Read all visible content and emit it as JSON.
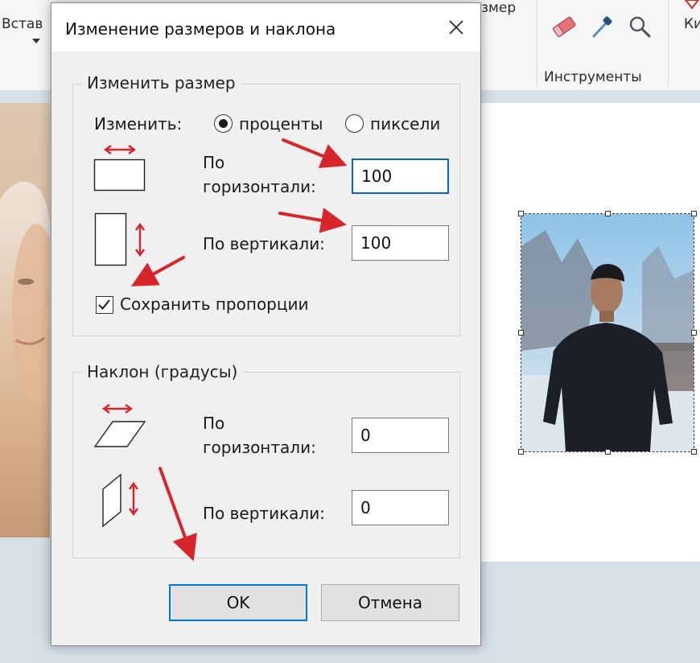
{
  "background_app": {
    "ribbon_insert_label": "Встав",
    "ribbon_resize_label": "змер",
    "ribbon_group_tools": "Инструменты",
    "ribbon_right_label": "Ки"
  },
  "dialog": {
    "title": "Изменение размеров и наклона",
    "resize_group": {
      "legend": "Изменить размер",
      "change_by_label": "Изменить:",
      "option_percent": "проценты",
      "option_pixels": "пиксели",
      "selected_option": "percent",
      "horizontal_label_line1": "По",
      "horizontal_label_line2": "горизонтали:",
      "horizontal_value": "100",
      "vertical_label": "По вертикали:",
      "vertical_value": "100",
      "keep_ratio_label": "Сохранить пропорции",
      "keep_ratio_checked": true
    },
    "skew_group": {
      "legend": "Наклон (градусы)",
      "horizontal_label_line1": "По",
      "horizontal_label_line2": "горизонтали:",
      "horizontal_value": "0",
      "vertical_label": "По вертикали:",
      "vertical_value": "0"
    },
    "ok_label": "OK",
    "cancel_label": "Отмена"
  },
  "colors": {
    "arrow_red": "#d6262b",
    "focus_blue": "#0a64c8",
    "default_button_border": "#0078d7"
  }
}
